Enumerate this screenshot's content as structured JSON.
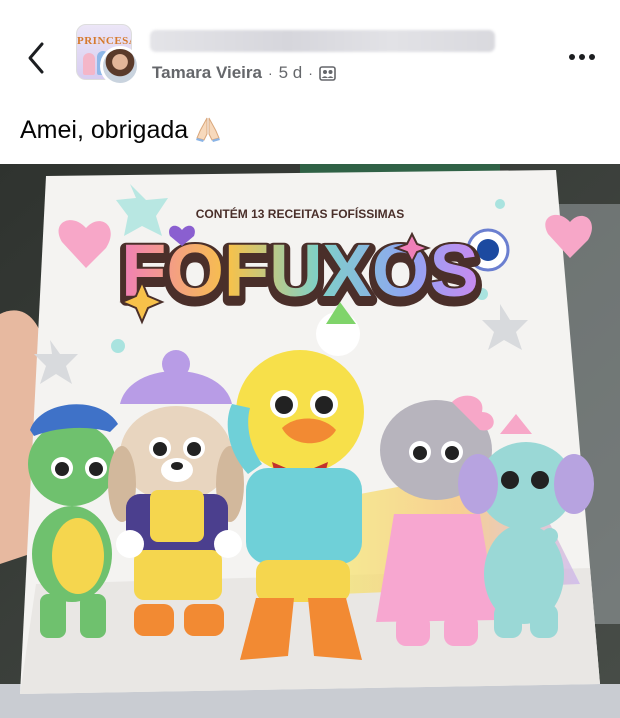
{
  "post": {
    "author": "Tamara Vieira",
    "age": "5 d",
    "separator": "·",
    "text": "Amei, obrigada",
    "group_avatar_text": "PRINCESA"
  },
  "book": {
    "subtitle": "CONTÉM 13 RECEITAS FOFÍSSIMAS",
    "title": "FOFUXOS"
  },
  "icons": {
    "back": "chevron-left-icon",
    "privacy": "group-members-icon",
    "more": "more-dots-icon",
    "emoji": "folded-hands-emoji"
  }
}
